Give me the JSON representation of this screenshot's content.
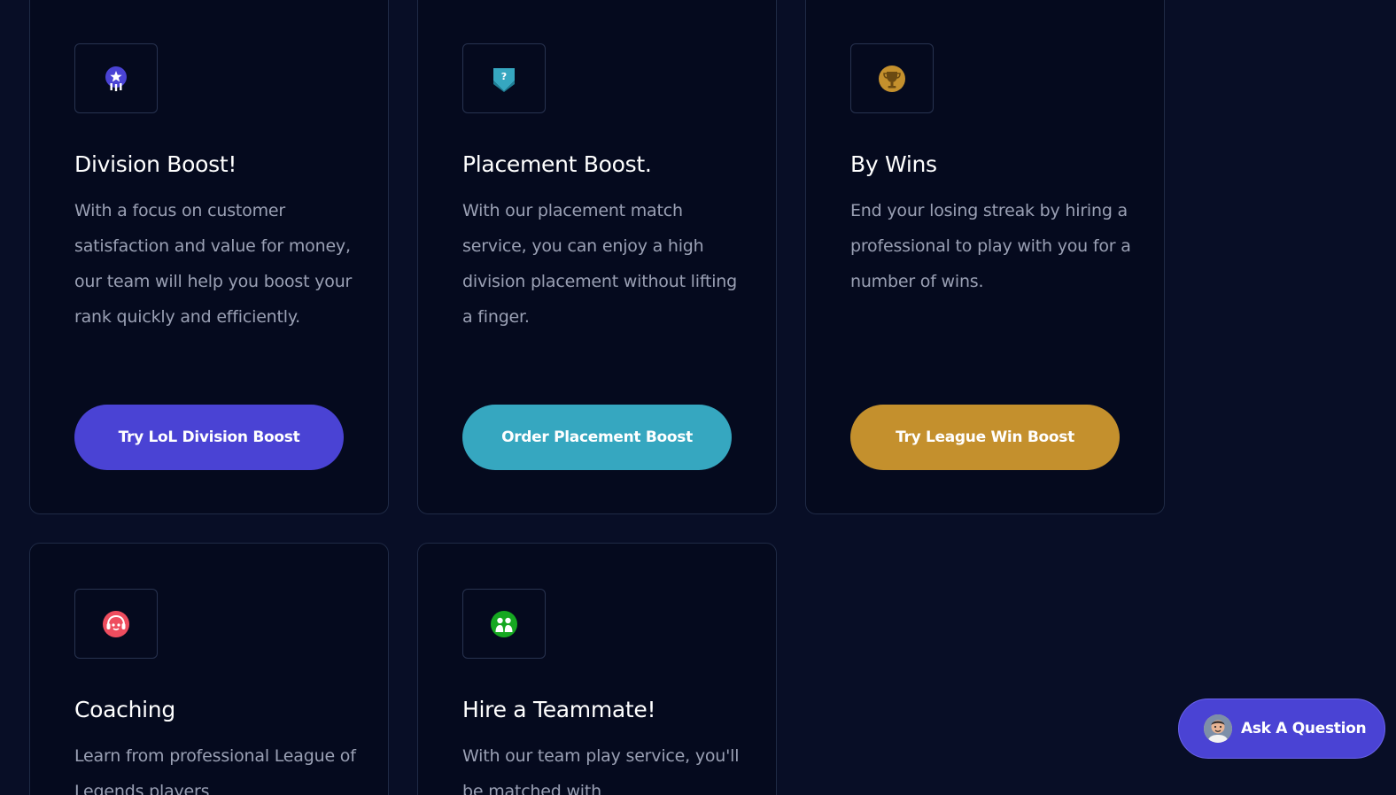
{
  "colors": {
    "page_background": "#080e26",
    "card_background": "#050a1e",
    "card_border": "#1f2a45",
    "heading": "#ffffff",
    "body_text": "#9aa0b4",
    "division_accent": "#4a43d4",
    "placement_accent": "#36a7c0",
    "wins_accent": "#c4902d",
    "coaching_accent": "#ee4d5f",
    "teammate_accent": "#16a821"
  },
  "services": [
    {
      "icon": "rank-badge-icon",
      "title": "Division Boost!",
      "description": "With a focus on customer satisfaction and value for money, our team will help you boost your rank quickly and efficiently.",
      "button_label": "Try LoL Division Boost"
    },
    {
      "icon": "placement-shield-icon",
      "title": "Placement Boost.",
      "description": "With our placement match service, you can enjoy a high division placement without lifting a finger.",
      "button_label": "Order Placement Boost"
    },
    {
      "icon": "trophy-icon",
      "title": "By Wins",
      "description": "End your losing streak by hiring a professional to play with you for a number of wins.",
      "button_label": "Try League Win Boost"
    },
    {
      "icon": "coach-face-icon",
      "title": "Coaching",
      "description": "Learn from professional League of Legends players"
    },
    {
      "icon": "teammate-duo-icon",
      "title": "Hire a Teammate!",
      "description": "With our team play service, you'll be matched with"
    }
  ],
  "chat_widget": {
    "label": "Ask A Question",
    "avatar": "support-agent-avatar"
  }
}
